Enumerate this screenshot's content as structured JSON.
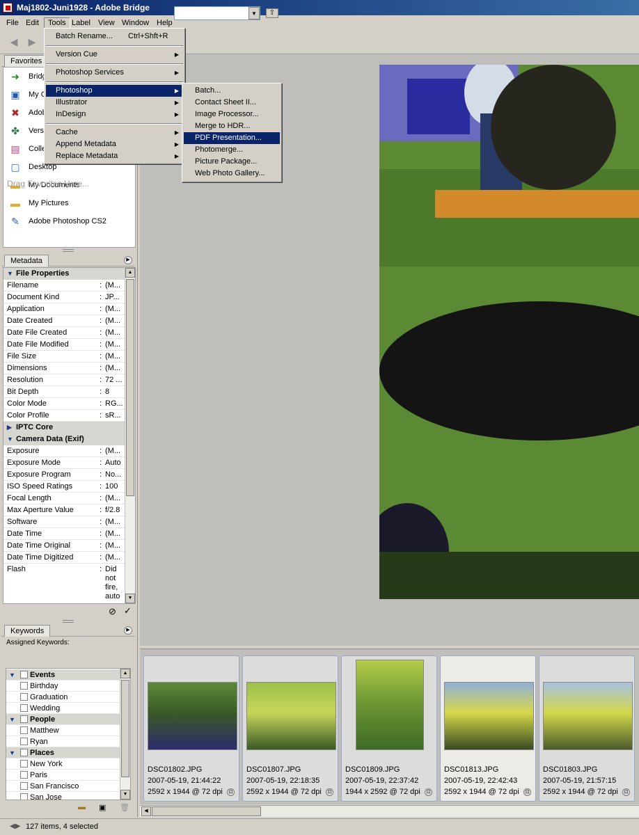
{
  "window": {
    "title": "Maj1802-Juni1928 - Adobe Bridge"
  },
  "menubar": [
    "File",
    "Edit",
    "Tools",
    "Label",
    "View",
    "Window",
    "Help"
  ],
  "tools_menu": {
    "items": [
      {
        "label": "Batch Rename...",
        "shortcut": "Ctrl+Shft+R",
        "submenu": false
      },
      {
        "label": "Version Cue",
        "submenu": true
      },
      {
        "label": "Photoshop Services",
        "submenu": true
      },
      {
        "label": "Photoshop",
        "submenu": true,
        "highlighted": true
      },
      {
        "label": "Illustrator",
        "submenu": true
      },
      {
        "label": "InDesign",
        "submenu": true
      },
      {
        "label": "Cache",
        "submenu": true
      },
      {
        "label": "Append Metadata",
        "submenu": true
      },
      {
        "label": "Replace Metadata",
        "submenu": true
      }
    ]
  },
  "photoshop_submenu": [
    "Batch...",
    "Contact Sheet II...",
    "Image Processor...",
    "Merge to HDR...",
    "PDF Presentation...",
    "Photomerge...",
    "Picture Package...",
    "Web Photo Gallery..."
  ],
  "photoshop_submenu_highlight": "PDF Presentation...",
  "favorites": {
    "tab": "Favorites",
    "items": [
      {
        "label": "Bridge",
        "icon": "bridge-icon"
      },
      {
        "label": "My Computer",
        "icon": "computer-icon"
      },
      {
        "label": "Adobe Stock Photos",
        "icon": "stock-photos-icon"
      },
      {
        "label": "Version Cue",
        "icon": "version-cue-icon"
      },
      {
        "label": "Collections",
        "icon": "collections-icon"
      },
      {
        "label": "Desktop",
        "icon": "desktop-icon"
      },
      {
        "label": "My Documents",
        "icon": "folder-icon"
      },
      {
        "label": "My Pictures",
        "icon": "pictures-folder-icon"
      },
      {
        "label": "Adobe Photoshop CS2",
        "icon": "photoshop-icon"
      }
    ],
    "drag_hint": "Drag Favorites Here..."
  },
  "metadata": {
    "tab": "Metadata",
    "groups": [
      {
        "name": "File Properties",
        "expanded": true,
        "rows": [
          [
            "Filename",
            "(M..."
          ],
          [
            "Document Kind",
            "JP..."
          ],
          [
            "Application",
            "(M..."
          ],
          [
            "Date Created",
            "(M..."
          ],
          [
            "Date File Created",
            "(M..."
          ],
          [
            "Date File Modified",
            "(M..."
          ],
          [
            "File Size",
            "(M..."
          ],
          [
            "Dimensions",
            "(M..."
          ],
          [
            "Resolution",
            "72 ..."
          ],
          [
            "Bit Depth",
            "8"
          ],
          [
            "Color Mode",
            "RG..."
          ],
          [
            "Color Profile",
            "sR..."
          ]
        ]
      },
      {
        "name": "IPTC Core",
        "expanded": false,
        "rows": []
      },
      {
        "name": "Camera Data (Exif)",
        "expanded": true,
        "rows": [
          [
            "Exposure",
            "(M..."
          ],
          [
            "Exposure Mode",
            "Auto"
          ],
          [
            "Exposure Program",
            "No..."
          ],
          [
            "ISO Speed Ratings",
            "100"
          ],
          [
            "Focal Length",
            "(M..."
          ],
          [
            "Max Aperture Value",
            "f/2.8"
          ],
          [
            "Software",
            "(M..."
          ],
          [
            "Date Time",
            "(M..."
          ],
          [
            "Date Time Original",
            "(M..."
          ],
          [
            "Date Time Digitized",
            "(M..."
          ]
        ]
      }
    ],
    "flash_label": "Flash",
    "flash_value": "Did not fire, auto"
  },
  "keywords": {
    "tab": "Keywords",
    "assigned_label": "Assigned Keywords:",
    "tree": [
      {
        "cat": "Events",
        "items": [
          "Birthday",
          "Graduation",
          "Wedding"
        ]
      },
      {
        "cat": "People",
        "items": [
          "Matthew",
          "Ryan"
        ]
      },
      {
        "cat": "Places",
        "items": [
          "New York",
          "Paris",
          "San Francisco",
          "San Jose"
        ]
      }
    ]
  },
  "thumbnails": [
    {
      "name": "DSC01802.JPG",
      "date": "2007-05-19, 21:44:22",
      "dims": "2592 x 1944 @ 72 dpi",
      "orientation": "landscape",
      "selected": true,
      "palette": [
        "#5d8a3a",
        "#3a5a25",
        "#2c2c6e"
      ]
    },
    {
      "name": "DSC01807.JPG",
      "date": "2007-05-19, 22:18:35",
      "dims": "2592 x 1944 @ 72 dpi",
      "orientation": "landscape",
      "selected": true,
      "palette": [
        "#9bc04a",
        "#c8d65a",
        "#3a5a25"
      ]
    },
    {
      "name": "DSC01809.JPG",
      "date": "2007-05-19, 22:37:42",
      "dims": "1944 x 2592 @ 72 dpi",
      "orientation": "portrait",
      "selected": true,
      "palette": [
        "#b6cc4a",
        "#6f9a35",
        "#3f6a25"
      ]
    },
    {
      "name": "DSC01813.JPG",
      "date": "2007-05-19, 22:42:43",
      "dims": "2592 x 1944 @ 72 dpi",
      "orientation": "landscape",
      "selected": false,
      "palette": [
        "#8fb0d8",
        "#d6d84a",
        "#3a4a22"
      ]
    },
    {
      "name": "DSC01803.JPG",
      "date": "2007-05-19, 21:57:15",
      "dims": "2592 x 1944 @ 72 dpi",
      "orientation": "landscape",
      "selected": true,
      "palette": [
        "#a8c0e0",
        "#d2d84a",
        "#4a5a2a"
      ]
    }
  ],
  "status": {
    "text": "127 items, 4 selected"
  }
}
